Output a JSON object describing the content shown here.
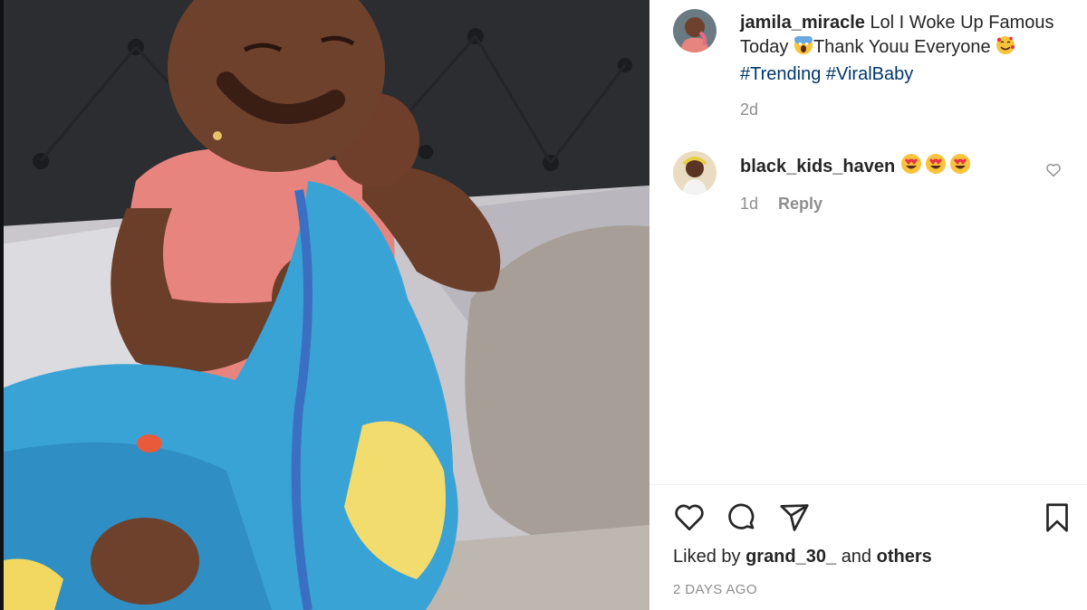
{
  "post": {
    "author": "jamila_miracle",
    "caption_line1": "Lol I Woke Up Famous",
    "caption_line2a": "Today",
    "caption_line2b": "Thank Youu Everyone",
    "hashtags": [
      "#Trending",
      "#ViralBaby"
    ],
    "age": "2d"
  },
  "comment": {
    "author": "black_kids_haven",
    "age": "1d",
    "reply_label": "Reply"
  },
  "footer": {
    "liked_by_prefix": "Liked by",
    "liked_by_user": "grand_30_",
    "liked_by_joiner": "and",
    "liked_by_others": "others",
    "date": "2 DAYS AGO"
  },
  "icons": {
    "like": "heart-icon",
    "comment": "comment-bubble-icon",
    "share": "paper-plane-icon",
    "save": "bookmark-icon",
    "comment_like": "small-heart-icon",
    "scream": "screaming-face-emoji",
    "smile_hearts": "smiling-face-with-hearts-emoji",
    "heart_eyes": "heart-eyes-emoji"
  },
  "colors": {
    "link": "#00376b",
    "muted": "#8e8e8e",
    "text": "#262626"
  }
}
